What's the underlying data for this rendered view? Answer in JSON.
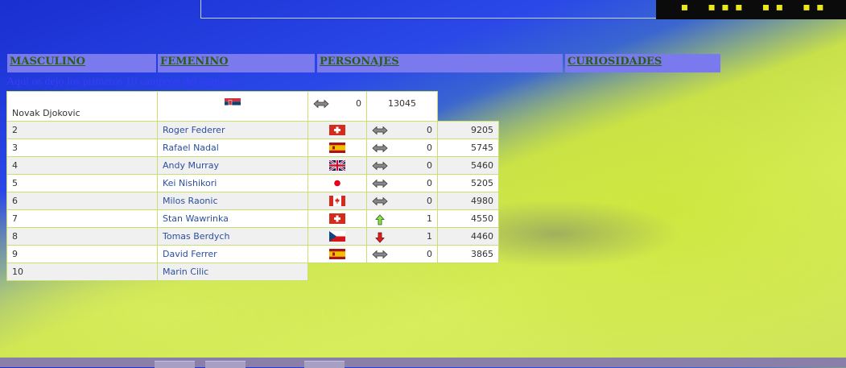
{
  "nav": [
    {
      "label": "MASCULINO"
    },
    {
      "label": "FEMENINO"
    },
    {
      "label": "PERSONAJES"
    },
    {
      "label": "CURIOSIDADES"
    }
  ],
  "intro": "Aqui os dejo los primeros 10 campeón del mundo",
  "rows": [
    {
      "pos": "",
      "name": "Novak Djokovic",
      "flag": "serbia-flag-icon",
      "trend": "same",
      "change": "0",
      "points": "13045"
    },
    {
      "pos": "2",
      "name": "Roger Federer",
      "flag": "switzerland-flag-icon",
      "trend": "same",
      "change": "0",
      "points": "9205"
    },
    {
      "pos": "3",
      "name": "Rafael Nadal",
      "flag": "spain-flag-icon",
      "trend": "same",
      "change": "0",
      "points": "5745"
    },
    {
      "pos": "4",
      "name": "Andy Murray",
      "flag": "uk-flag-icon",
      "trend": "same",
      "change": "0",
      "points": "5460"
    },
    {
      "pos": "5",
      "name": "Kei Nishikori",
      "flag": "japan-flag-icon",
      "trend": "same",
      "change": "0",
      "points": "5205"
    },
    {
      "pos": "6",
      "name": "Milos Raonic",
      "flag": "canada-flag-icon",
      "trend": "same",
      "change": "0",
      "points": "4980"
    },
    {
      "pos": "7",
      "name": "Stan Wawrinka",
      "flag": "switzerland-flag-icon",
      "trend": "up",
      "change": "1",
      "points": "4550"
    },
    {
      "pos": "8",
      "name": "Tomas Berdych",
      "flag": "czech-flag-icon",
      "trend": "down",
      "change": "1",
      "points": "4460"
    },
    {
      "pos": "9",
      "name": "David Ferrer",
      "flag": "spain-flag-icon",
      "trend": "same",
      "change": "0",
      "points": "3865"
    },
    {
      "pos": "10",
      "name": "Marin Cilic"
    }
  ]
}
